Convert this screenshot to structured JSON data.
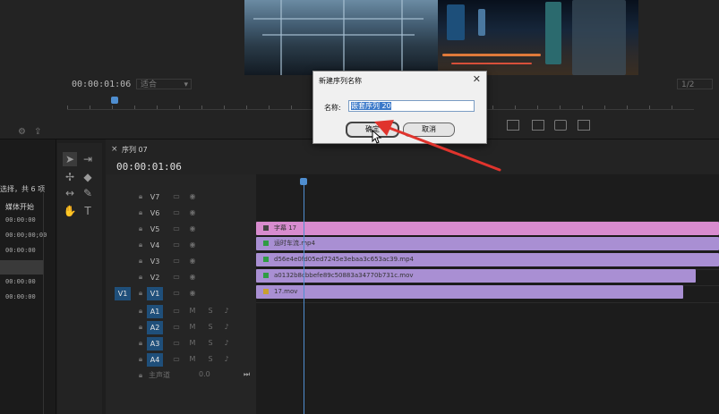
{
  "monitor": {
    "timecode": "00:00:01:06",
    "dropdown": "适合",
    "right_dropdown": "1/2"
  },
  "project": {
    "selection_text": "选择，共 6 项",
    "column_header": "媒体开始",
    "rows": [
      "00:00:00",
      "00:00;00;00",
      "00:00:00",
      "00:00:00",
      "00:00:00",
      "00:00:00"
    ]
  },
  "timeline": {
    "sequence_tab": "序列 07",
    "timecode": "00:00:01:06",
    "video_tracks": [
      "V7",
      "V6",
      "V5",
      "V4",
      "V3",
      "V2",
      "V1"
    ],
    "source_v1": "V1",
    "audio_tracks": [
      "A1",
      "A2",
      "A3",
      "A4"
    ],
    "master_label": "主声道",
    "master_value": "0.0",
    "clips": [
      {
        "track": "V5",
        "label": "字幕 17",
        "color": "#d88ccf"
      },
      {
        "track": "V4",
        "label": "运时车流.mp4",
        "color": "#a98fd3"
      },
      {
        "track": "V3",
        "label": "d56e4e0fd05ed7245e3ebaa3c653ac39.mp4",
        "color": "#a98fd3"
      },
      {
        "track": "V2",
        "label": "a0132b8cbbefe89c50883a34770b731c.mov",
        "color": "#a98fd3"
      },
      {
        "track": "V1",
        "label": "17.mov",
        "color": "#a98fd3"
      }
    ]
  },
  "dialog": {
    "title": "新建序列名称",
    "close": "✕",
    "name_label": "名称:",
    "name_value": "嵌套序列 20",
    "ok": "确定",
    "cancel": "取消"
  },
  "colors": {
    "accent": "#1f4f7a",
    "playhead": "#4f8ed0",
    "clip_purple": "#a98fd3",
    "clip_pink": "#d88ccf",
    "arrow": "#e0342d"
  }
}
